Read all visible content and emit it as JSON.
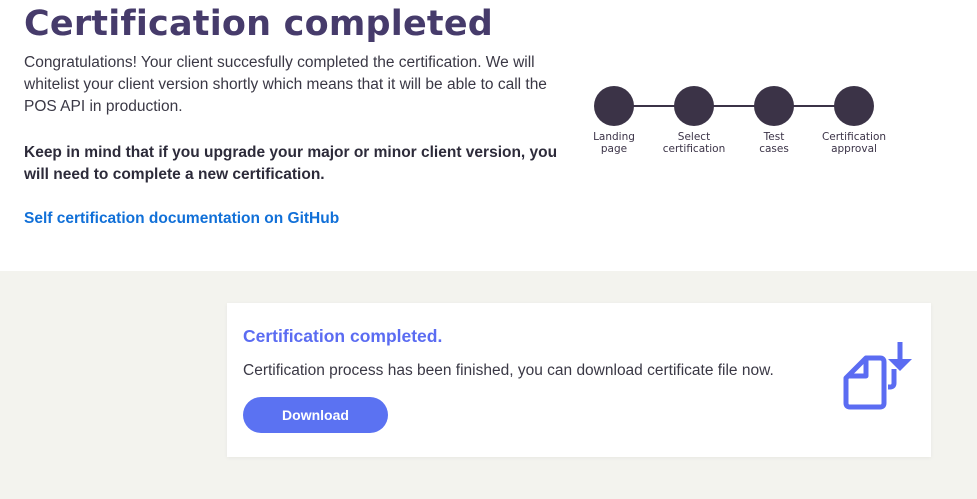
{
  "header": {
    "title": "Certification completed",
    "intro": "Congratulations! Your client succesfully completed the certification. We will whitelist your client version shortly which means that it will be able to call the POS API in production.",
    "warning": "Keep in mind that if you upgrade your major or minor client version, you will need to complete a new certification.",
    "doc_link": "Self certification documentation on GitHub"
  },
  "stepper": {
    "color": "#3b3347",
    "steps": [
      {
        "label_line1": "Landing",
        "label_line2": "page"
      },
      {
        "label_line1": "Select",
        "label_line2": "certification"
      },
      {
        "label_line1": "Test",
        "label_line2": "cases"
      },
      {
        "label_line1": "Certification",
        "label_line2": "approval"
      }
    ]
  },
  "card": {
    "title": "Certification completed.",
    "text": "Certification process has been finished, you can download certificate file now.",
    "download_label": "Download",
    "icon": "download-file-icon",
    "accent": "#5b6cf2"
  }
}
